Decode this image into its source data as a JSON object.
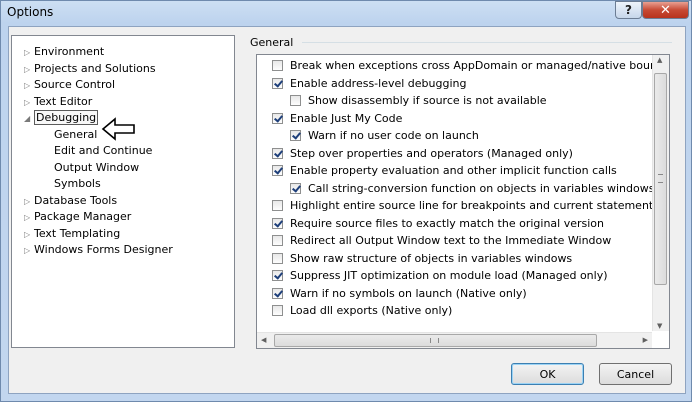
{
  "window": {
    "title": "Options",
    "help_glyph": "?",
    "close_glyph": "✕"
  },
  "tree": {
    "items": [
      {
        "label": "Environment",
        "arrow": "▷"
      },
      {
        "label": "Projects and Solutions",
        "arrow": "▷"
      },
      {
        "label": "Source Control",
        "arrow": "▷"
      },
      {
        "label": "Text Editor",
        "arrow": "▷"
      },
      {
        "label": "Debugging",
        "arrow": "◢"
      },
      {
        "label": "General",
        "arrow": ""
      },
      {
        "label": "Edit and Continue",
        "arrow": ""
      },
      {
        "label": "Output Window",
        "arrow": ""
      },
      {
        "label": "Symbols",
        "arrow": ""
      },
      {
        "label": "Database Tools",
        "arrow": "▷"
      },
      {
        "label": "Package Manager",
        "arrow": "▷"
      },
      {
        "label": "Text Templating",
        "arrow": "▷"
      },
      {
        "label": "Windows Forms Designer",
        "arrow": "▷"
      }
    ],
    "selected": "Debugging"
  },
  "general": {
    "group_label": "General",
    "options": [
      {
        "label": "Break when exceptions cross AppDomain or managed/native boundaries (M",
        "checked": false
      },
      {
        "label": "Enable address-level debugging",
        "checked": true
      },
      {
        "label": "Show disassembly if source is not available",
        "checked": false
      },
      {
        "label": "Enable Just My Code",
        "checked": true
      },
      {
        "label": "Warn if no user code on launch",
        "checked": true
      },
      {
        "label": "Step over properties and operators (Managed only)",
        "checked": true
      },
      {
        "label": "Enable property evaluation and other implicit function calls",
        "checked": true
      },
      {
        "label": "Call string-conversion function on objects in variables windows",
        "checked": true
      },
      {
        "label": "Highlight entire source line for breakpoints and current statement",
        "checked": false
      },
      {
        "label": "Require source files to exactly match the original version",
        "checked": true
      },
      {
        "label": "Redirect all Output Window text to the Immediate Window",
        "checked": false
      },
      {
        "label": "Show raw structure of objects in variables windows",
        "checked": false
      },
      {
        "label": "Suppress JIT optimization on module load (Managed only)",
        "checked": true
      },
      {
        "label": "Warn if no symbols on launch (Native only)",
        "checked": true
      },
      {
        "label": "Load dll exports (Native only)",
        "checked": false
      }
    ]
  },
  "buttons": {
    "ok": "OK",
    "cancel": "Cancel"
  }
}
